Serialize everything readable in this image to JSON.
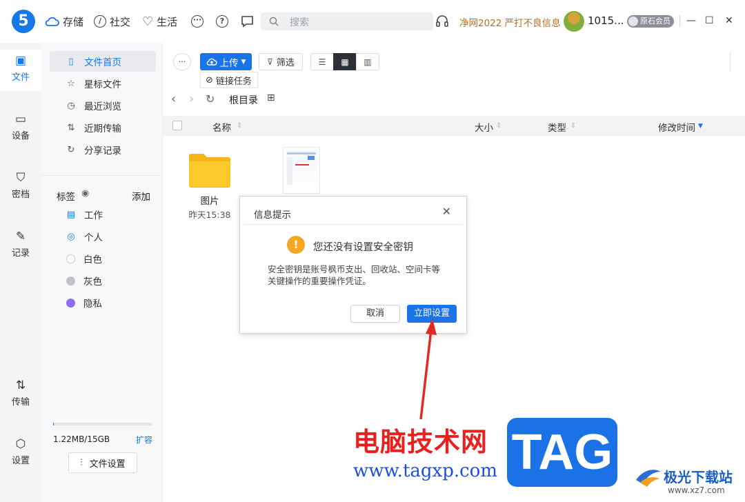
{
  "topbar": {
    "logo": "5",
    "nav": [
      {
        "label": "存储",
        "icon": "cloud-icon"
      },
      {
        "label": "社交",
        "icon": "clock-icon"
      },
      {
        "label": "生活",
        "icon": "heart-icon"
      }
    ],
    "search_placeholder": "搜索",
    "promo": "净网2022 严打不良信息",
    "username": "1015...",
    "vip_label": "原石会员",
    "window": {
      "minimize": "—",
      "maximize": "☐",
      "close": "✕"
    }
  },
  "rail": [
    {
      "label": "文件",
      "icon": "folder-icon",
      "active": true
    },
    {
      "label": "设备",
      "icon": "device-icon"
    },
    {
      "label": "密档",
      "icon": "shield-icon"
    },
    {
      "label": "记录",
      "icon": "pen-icon"
    },
    {
      "label": "传输",
      "icon": "transfer-icon"
    },
    {
      "label": "设置",
      "icon": "settings-icon"
    }
  ],
  "sidebar": {
    "items": [
      {
        "label": "文件首页",
        "icon": "file-icon"
      },
      {
        "label": "星标文件",
        "icon": "star-icon"
      },
      {
        "label": "最近浏览",
        "icon": "history-icon"
      },
      {
        "label": "近期传输",
        "icon": "transfer-icon"
      },
      {
        "label": "分享记录",
        "icon": "share-icon"
      }
    ],
    "tags_title": "标签",
    "tags_add": "添加",
    "tags": [
      {
        "label": "工作",
        "icon": "briefcase-icon"
      },
      {
        "label": "个人",
        "icon": "user-icon"
      },
      {
        "label": "白色",
        "color": "#ffffff"
      },
      {
        "label": "灰色",
        "color": "#c0c2c6"
      },
      {
        "label": "隐私",
        "color": "#8e6cf0"
      }
    ],
    "storage": {
      "used": "1.22MB/15GB",
      "expand": "扩容",
      "used_fraction": 0.0001
    },
    "settings_button": "文件设置"
  },
  "toolbar": {
    "upload": "上传",
    "link_task": "链接任务",
    "filter": "筛选"
  },
  "path": {
    "root": "根目录"
  },
  "table_headers": {
    "name": "名称",
    "size": "大小",
    "type": "类型",
    "modified": "修改时间"
  },
  "files": [
    {
      "name": "图片",
      "time": "昨天15:38",
      "kind": "folder"
    },
    {
      "name": "",
      "time": "",
      "kind": "image"
    }
  ],
  "dialog": {
    "title": "信息提示",
    "heading": "您还没有设置安全密钥",
    "body": "安全密钥是账号枫币支出、回收站、空间卡等关键操作的重要操作凭证。",
    "cancel": "取消",
    "confirm": "立即设置"
  },
  "watermark": {
    "cn": "电脑技术网",
    "url": "www.tagxp.com",
    "tag": "TAG",
    "site": "极光下载站",
    "site_url": "www.xz7.com"
  }
}
